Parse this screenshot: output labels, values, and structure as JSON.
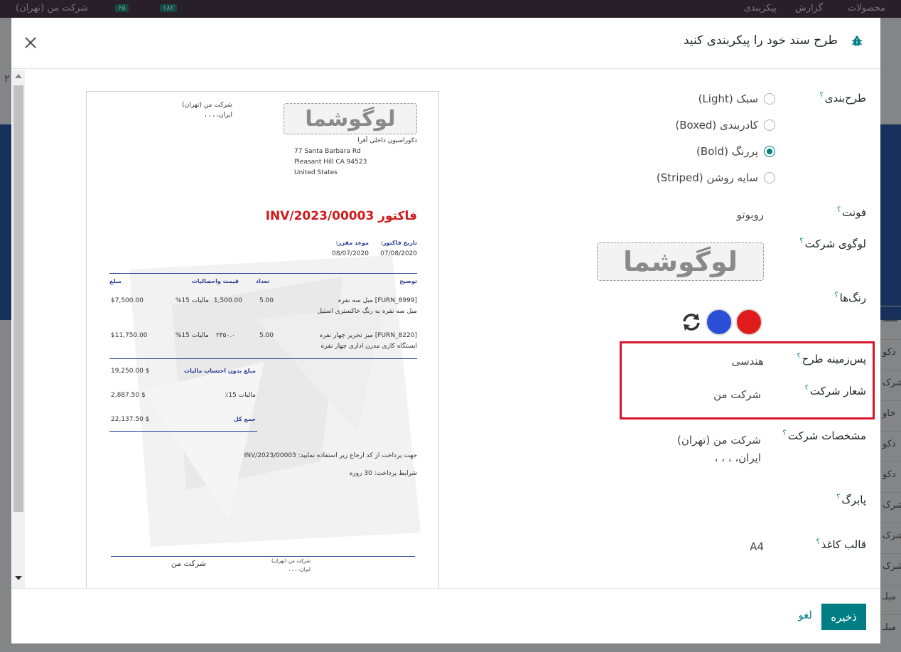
{
  "background": {
    "nav_items": [
      "محصولات",
      "گزارش",
      "پیکربندی"
    ],
    "company_switch": "شرکت من (تهران)",
    "badge_1": "۱۸۲",
    "badge_2": "۶۵",
    "left_number": "۲",
    "row_labels": [
      "مشـ",
      "دکو",
      "شرک",
      "خاو",
      "دکو",
      "دکو",
      "شرک",
      "شرک",
      "شرک",
      "مبلـ",
      "مبلـ"
    ]
  },
  "modal": {
    "title": "طرح سند خود را پیکربندی کنید",
    "close_icon": "close-icon",
    "bug_icon": "bug-icon"
  },
  "form": {
    "layout": {
      "label": "طرح‌بندی",
      "help": "؟",
      "options": [
        "سبک (Light)",
        "کادربندی (Boxed)",
        "پررنگ (Bold)",
        "سایه روشن (Striped)"
      ],
      "selected": "پررنگ (Bold)"
    },
    "font": {
      "label": "فونت",
      "help": "؟",
      "value": "روبوتو"
    },
    "logo": {
      "label": "لوگوی شرکت",
      "help": "؟",
      "text": "لوگوشما"
    },
    "colors": {
      "label": "رنگ‌ها",
      "help": "؟",
      "primary": "#e01b1b",
      "secondary": "#2a4fd6",
      "reset_icon": "refresh-icon"
    },
    "background": {
      "label": "پس‌زمینه طرح",
      "help": "؟",
      "value": "هندسی"
    },
    "tagline": {
      "label": "شعار شرکت",
      "help": "؟",
      "value": "شرکت من"
    },
    "company_details": {
      "label": "مشخصات شرکت",
      "help": "؟",
      "line1": "شرکت من (تهران)",
      "line2": "ایران، ، ، ،"
    },
    "footer": {
      "label": "پابرگ",
      "help": "؟"
    },
    "paper_format": {
      "label": "قالب کاغذ",
      "help": "؟",
      "value": "A4"
    }
  },
  "preview": {
    "logo_text": "لوگوشما",
    "company_name": "شرکت من (تهران)",
    "company_country": "ایران، ، ، ،",
    "customer_name": "دکوراسیون داخلی آفرا",
    "address_1": "77 Santa Barbara Rd",
    "address_2": "Pleasant Hill CA 94523",
    "address_3": "United States",
    "invoice_title": "فاکتور INV/2023/00003",
    "invoice_date_label": "تاریخ فاکتور:",
    "invoice_date": "07/08/2020",
    "due_date_label": "موعد مقرر:",
    "due_date": "08/07/2020",
    "columns": [
      "توضیح",
      "تعداد",
      "قیمت واحد",
      "مالیات",
      "مبلغ"
    ],
    "lines": [
      {
        "desc1": "[FURN_8999] مبل سه نفره",
        "desc2": "مبل سه نفره به رنگ خاکستری استیل",
        "qty": "5.00",
        "price": "1,500.00",
        "tax": "مالیات 15%",
        "amount": "$7,500.00"
      },
      {
        "desc1": "[FURN_8220] میز تحریر چهار نفره",
        "desc2": "ایستگاه کاری مدرن اداری چهار نفره",
        "qty": "5.00",
        "price": "۲۳۵۰.۰",
        "tax": "مالیات 15%",
        "amount": "$11,750.00"
      }
    ],
    "untaxed_label": "مبلغ بدون احتساب مالیات",
    "untaxed": "19,250.00 $",
    "tax_label": "مالیات 15٪",
    "tax_total": "2,887.50 $",
    "total_label": "جمع کل",
    "total": "22,137.50 $",
    "payment_ref": "جهت پرداخت از کد ارجاع زیر استفاده نمایید: INV/2023/00003",
    "payment_terms": "شرایط پرداخت: 30 روزه",
    "footer_tagline": "شرکت من",
    "footer_company": "شرکت من (تهران)",
    "footer_country": "ایران، ، ، ،"
  },
  "buttons": {
    "save": "ذخیره",
    "cancel": "لغو"
  }
}
